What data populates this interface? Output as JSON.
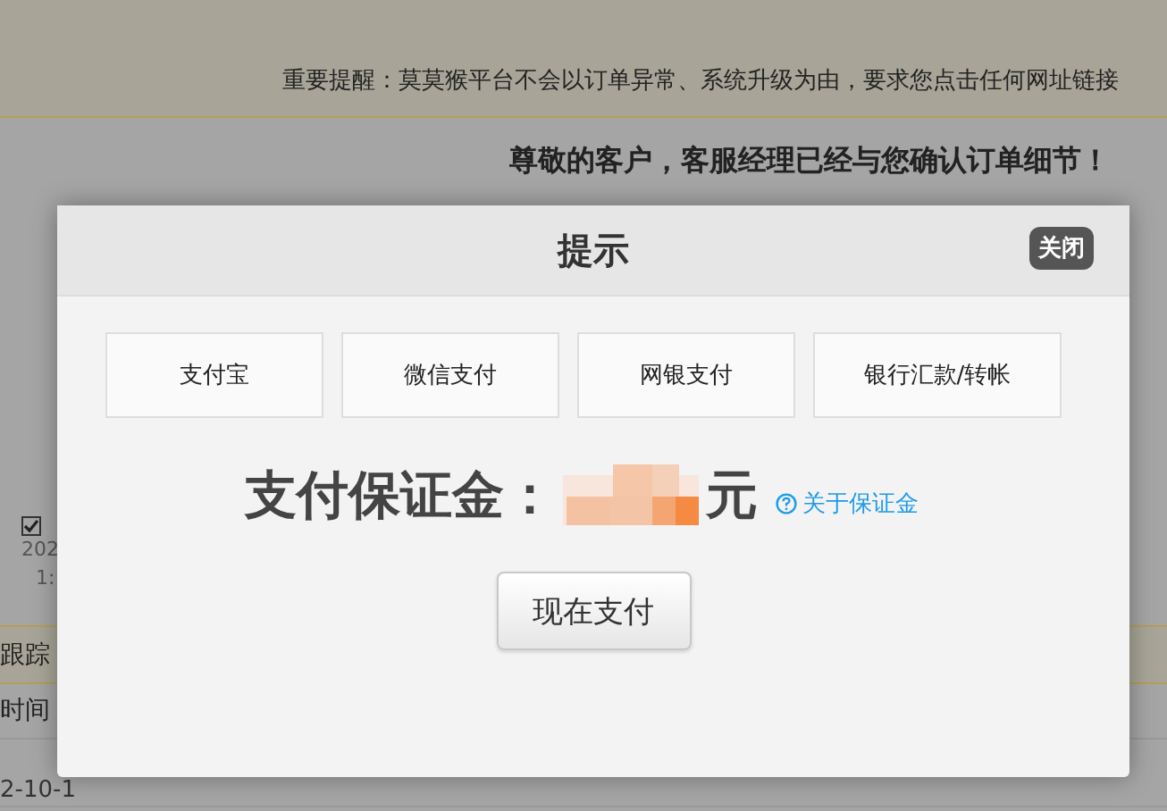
{
  "page": {
    "notice": "重要提醒：莫莫猴平台不会以订单异常、系统升级为由，要求您点击任何网址链接",
    "greeting": "尊敬的客户，客服经理已经与您确认订单细节！",
    "left_column": {
      "checked": true,
      "date": "202",
      "time": "1:"
    },
    "tracking_header": "跟踪",
    "time_header": "时间",
    "first_row_time": "2-10-1"
  },
  "dialog": {
    "title": "提示",
    "close": "关闭",
    "payment_methods": [
      {
        "label": "支付宝"
      },
      {
        "label": "微信支付"
      },
      {
        "label": "网银支付"
      },
      {
        "label": "银行汇款/转帐"
      }
    ],
    "amount_label": "支付保证金：",
    "currency": "元",
    "help_link": "关于保证金",
    "pay_button": "现在支付"
  }
}
